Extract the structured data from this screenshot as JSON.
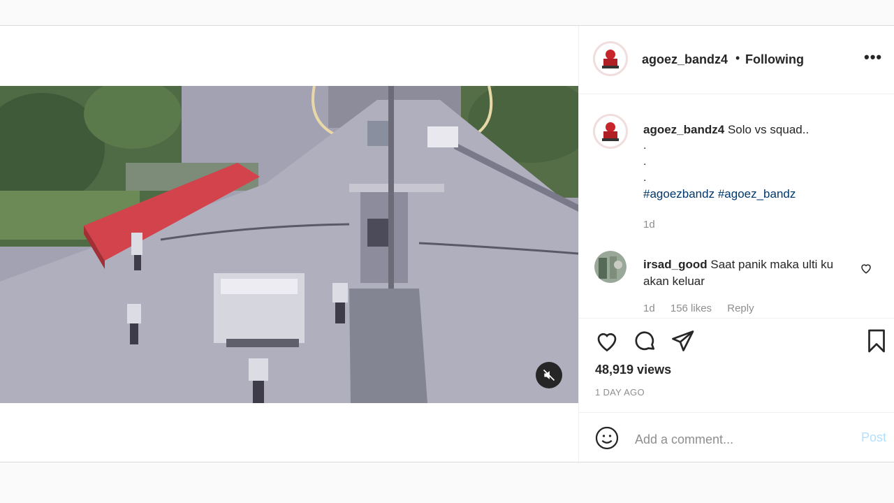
{
  "post": {
    "author": "agoez_bandz4",
    "separator": "•",
    "follow_state": "Following",
    "more": "•••",
    "caption": {
      "username": "agoez_bandz4",
      "text": "Solo vs squad..",
      "dots": [
        ".",
        ".",
        "."
      ],
      "hashtags": [
        "#agoezbandz",
        "#agoez_bandz"
      ],
      "age": "1d"
    },
    "comment": {
      "username": "irsad_good",
      "text": "Saat panik maka ulti ku akan keluar",
      "age": "1d",
      "likes": "156 likes",
      "reply": "Reply"
    },
    "views": "48,919 views",
    "time_ago": "1 DAY AGO",
    "comment_input": {
      "placeholder": "Add a comment...",
      "post_label": "Post"
    }
  },
  "icons": {
    "like": "heart-icon",
    "comment": "comment-bubble-icon",
    "share": "paper-plane-icon",
    "save": "bookmark-icon",
    "emoji": "emoji-icon",
    "mute": "speaker-muted-icon"
  }
}
